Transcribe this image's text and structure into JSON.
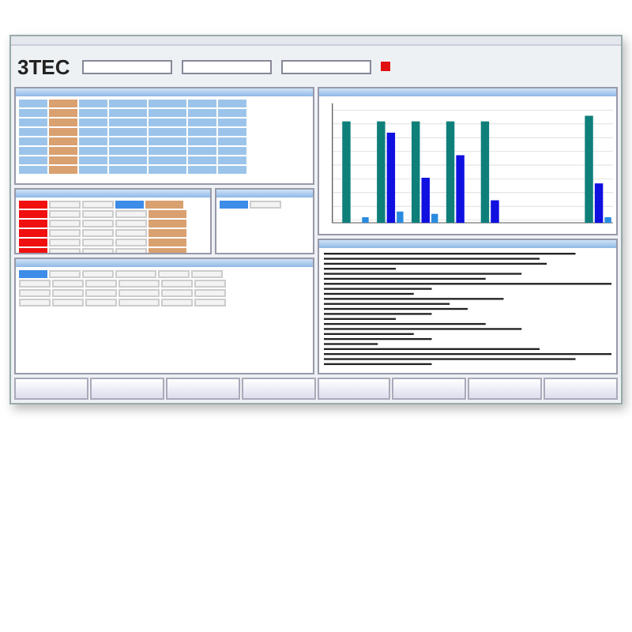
{
  "logo": {
    "text": "3TEC"
  }
}
